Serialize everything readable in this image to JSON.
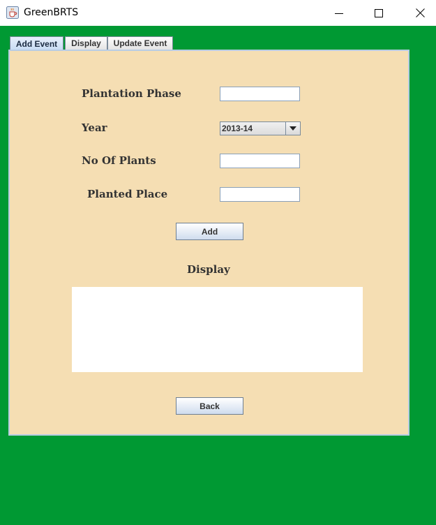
{
  "window": {
    "title": "GreenBRTS",
    "icon": "java-cup-icon"
  },
  "tabs": [
    {
      "label": "Add Event",
      "selected": true
    },
    {
      "label": "Display",
      "selected": false
    },
    {
      "label": "Update Event",
      "selected": false
    }
  ],
  "form": {
    "plantation_phase_label": "Plantation Phase",
    "plantation_phase_value": "",
    "year_label": "Year",
    "year_value": "2013-14",
    "no_of_plants_label": "No Of Plants",
    "no_of_plants_value": "",
    "planted_place_label": "Planted Place",
    "planted_place_value": ""
  },
  "buttons": {
    "add": "Add",
    "back": "Back"
  },
  "display": {
    "heading": "Display",
    "content": ""
  },
  "colors": {
    "background": "#009933",
    "panel": "#f5deb3"
  }
}
